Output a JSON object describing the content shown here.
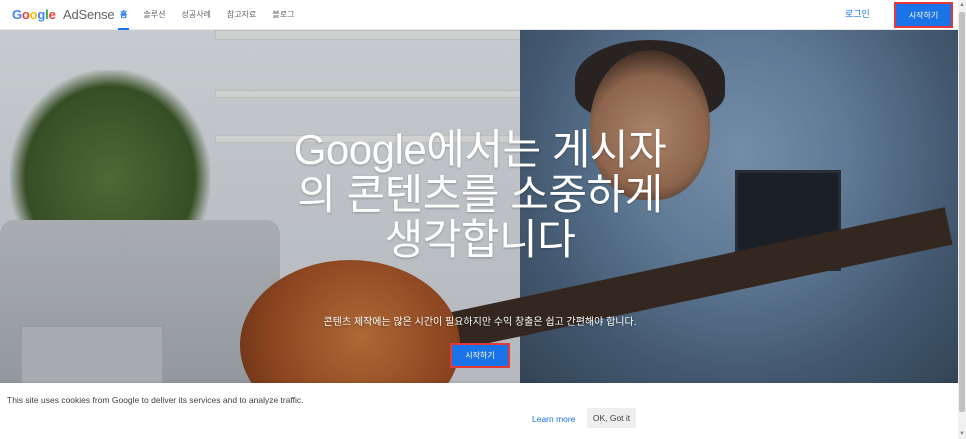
{
  "header": {
    "logo_google": "Google",
    "logo_product": "AdSense",
    "nav": [
      {
        "label": "홈",
        "active": true
      },
      {
        "label": "솔루션",
        "active": false
      },
      {
        "label": "성공사례",
        "active": false
      },
      {
        "label": "참고자료",
        "active": false
      },
      {
        "label": "블로그",
        "active": false
      }
    ],
    "login_label": "로그인",
    "start_label": "시작하기"
  },
  "hero": {
    "title": "Google에서는 게시자의 콘텐츠를 소중하게 생각합니다",
    "subtitle": "콘텐츠 제작에는 많은 시간이 필요하지만 수익 창출은 쉽고 간편해야 합니다.",
    "cta_label": "시작하기"
  },
  "cookie_bar": {
    "text": "This site uses cookies from Google to deliver its services and to analyze traffic.",
    "learn_more": "Learn more",
    "ok_label": "OK, Got it"
  },
  "colors": {
    "accent": "#1a73e8",
    "highlight_border": "#e53935"
  }
}
